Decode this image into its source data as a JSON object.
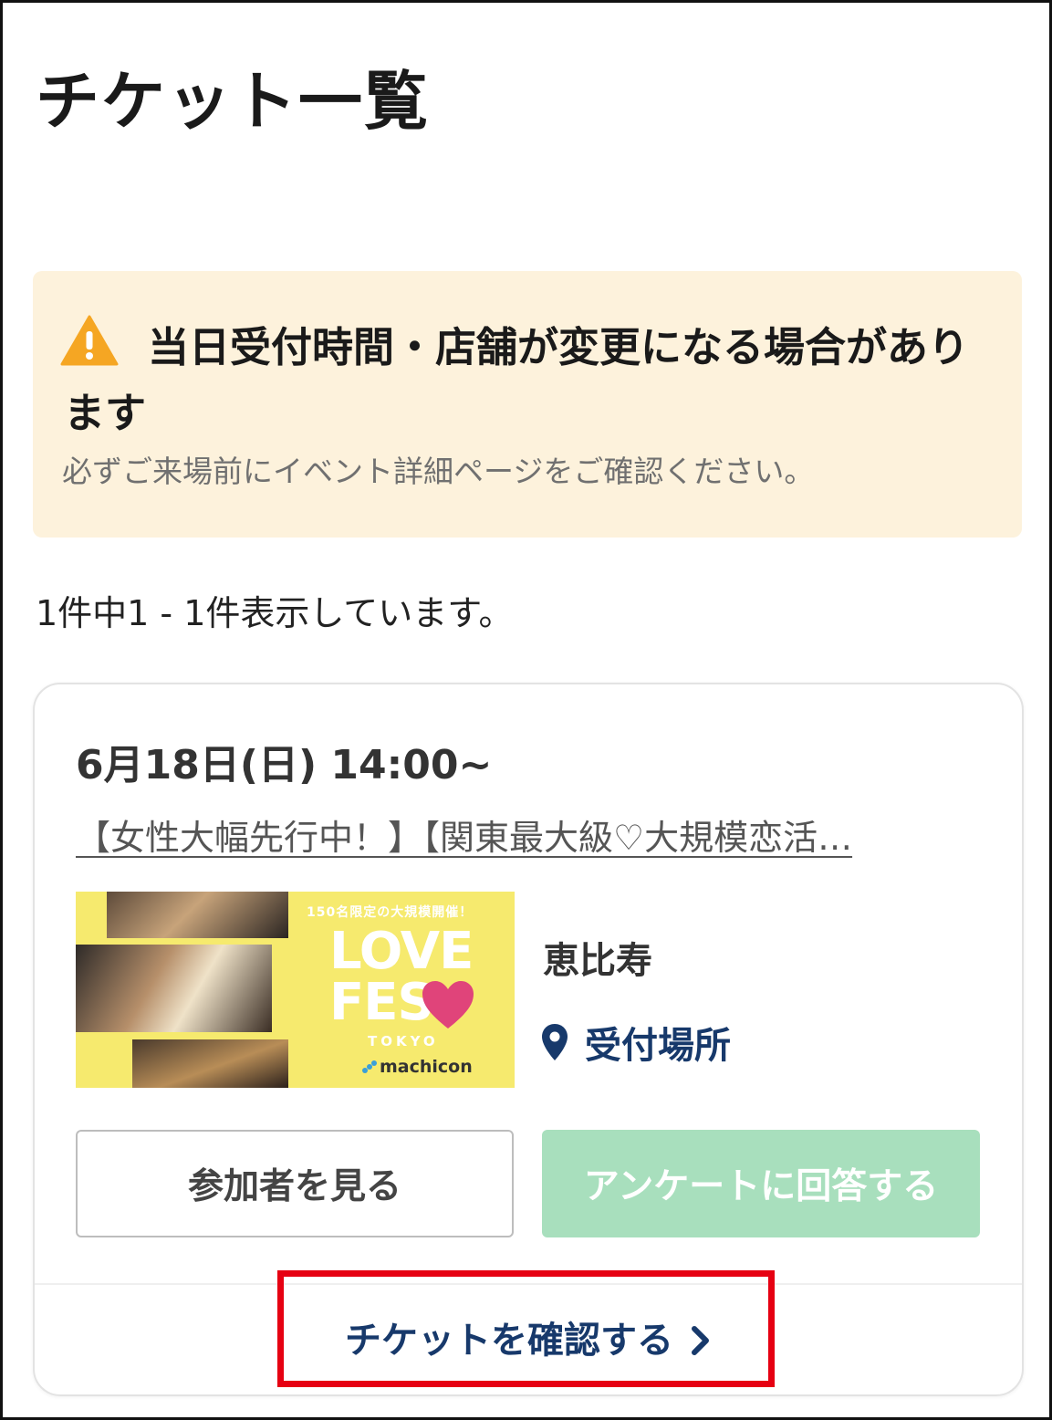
{
  "page": {
    "title": "チケット一覧"
  },
  "notice": {
    "icon": "warning-triangle-icon",
    "headline": "当日受付時間・店舗が変更になる場合があります",
    "sub": "必ずご来場前にイベント詳細ページをご確認ください。",
    "bg_color": "#fdf2dc"
  },
  "results": {
    "count_text": "1件中1 - 1件表示しています。"
  },
  "ticket": {
    "datetime": "6月18日(日) 14:00~",
    "event_title": "【女性大幅先行中！】【関東最大級♡大規模恋活…",
    "thumbnail": {
      "caption": "150名限定の大規模開催！",
      "logo_line1": "LOVE",
      "logo_line2": "FES",
      "logo_city": "TOKYO",
      "brand": "machicon"
    },
    "area": "恵比寿",
    "reception": {
      "icon": "map-pin-icon",
      "label": "受付場所"
    },
    "buttons": {
      "participants": "参加者を見る",
      "survey": "アンケートに回答する"
    },
    "confirm": {
      "label": "チケットを確認する",
      "icon": "chevron-right-icon"
    }
  },
  "colors": {
    "navy": "#17396b",
    "survey_green": "#a8dfbd",
    "highlight_red": "#e60012",
    "warning_orange": "#f5a623"
  }
}
